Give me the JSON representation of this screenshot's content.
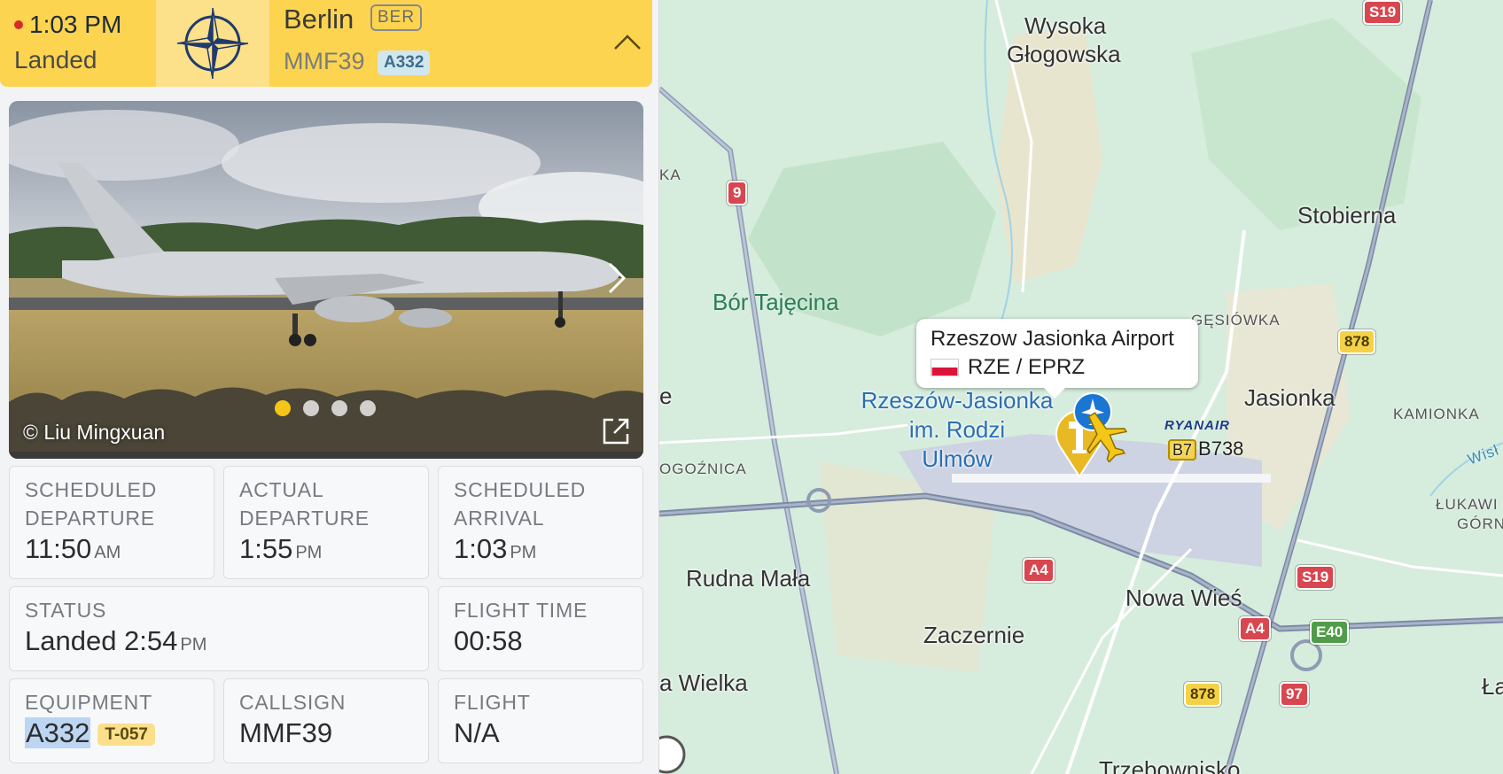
{
  "header": {
    "time": "1:03 PM",
    "status": "Landed",
    "logo_icon": "nato-compass-rose-icon",
    "destination_city": "Berlin",
    "destination_iata": "BER",
    "callsign": "MMF39",
    "aircraft_type": "A332",
    "accent_color": "#fdd44f"
  },
  "photo": {
    "credit": "© Liu Mingxuan",
    "slide_count": 4,
    "active_slide": 1
  },
  "details": {
    "scheduled_departure": {
      "label": "SCHEDULED DEPARTURE",
      "value": "11:50",
      "ampm": "AM"
    },
    "actual_departure": {
      "label": "ACTUAL DEPARTURE",
      "value": "1:55",
      "ampm": "PM"
    },
    "scheduled_arrival": {
      "label": "SCHEDULED ARRIVAL",
      "value": "1:03",
      "ampm": "PM"
    },
    "status": {
      "label": "STATUS",
      "value": "Landed 2:54",
      "ampm": "PM"
    },
    "flight_time": {
      "label": "FLIGHT TIME",
      "value": "00:58"
    },
    "equipment": {
      "label": "EQUIPMENT",
      "value": "A332",
      "registration": "T-057"
    },
    "callsign": {
      "label": "CALLSIGN",
      "value": "MMF39"
    },
    "flight": {
      "label": "FLIGHT",
      "value": "N/A"
    }
  },
  "map": {
    "popup": {
      "airport_name": "Rzeszow Jasionka Airport",
      "codes": "RZE / EPRZ"
    },
    "airport_label_lines": [
      "Rzeszów-Jasionka",
      "im. Rodzi",
      "Ulmów"
    ],
    "towns": {
      "wysoka": "Wysoka",
      "glogowska": "Głogowska",
      "stobierna": "Stobierna",
      "jasionka": "Jasionka",
      "rudna_mala": "Rudna Mała",
      "nowa_wies": "Nowa Wieś",
      "zaczernie": "Zaczernie",
      "wielka": "a Wielka",
      "trzebownisko": "Trzebownisko",
      "la": "Ła",
      "e": "e"
    },
    "small_towns": {
      "gesiowka": "GĘSIÓWKA",
      "kamionka": "KAMIONKA",
      "ka": "KA",
      "ogoznica": "OGOŹNICA",
      "lukawiec": "ŁUKAWI",
      "gorny": "GÓRNY",
      "wisl": "Wisł"
    },
    "forest": "Bór Tajęcina",
    "airline_label": "RYANAIR",
    "aircraft_label": "B738",
    "aircraft_tag": "B7",
    "road_shields": {
      "s19_top": "S19",
      "r9": "9",
      "r878_a": "878",
      "a4_mid": "A4",
      "s19_mid": "S19",
      "a4_right": "A4",
      "e40": "E40",
      "r878_b": "878",
      "r97": "97"
    }
  }
}
